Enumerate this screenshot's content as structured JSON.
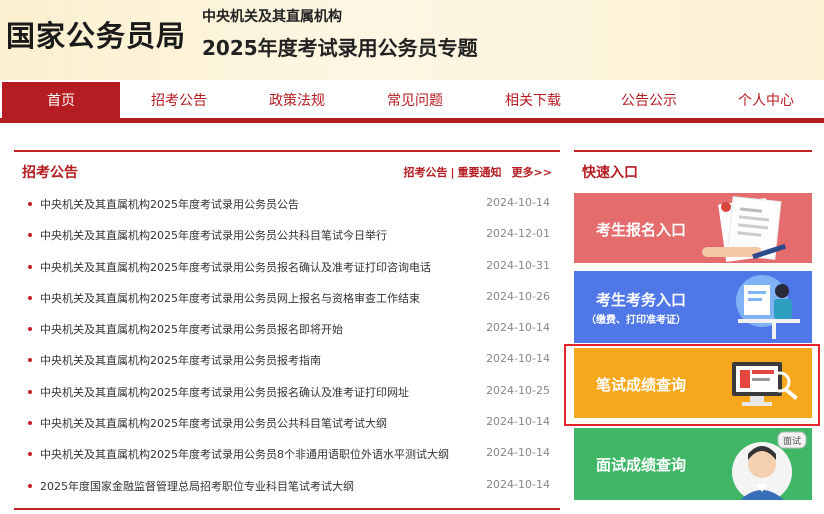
{
  "header": {
    "logo": "国家公务员局",
    "sub1": "中央机关及其直属机构",
    "sub2": "2025年度考试录用公务员专题"
  },
  "nav": {
    "items": [
      "首页",
      "招考公告",
      "政策法规",
      "常见问题",
      "相关下载",
      "公告公示",
      "个人中心"
    ],
    "active_index": 0
  },
  "left_panel": {
    "title": "招考公告",
    "link1": "招考公告",
    "separator": "|",
    "link2": "重要通知",
    "more": "更多>>",
    "news": [
      {
        "title": "中央机关及其直属机构2025年度考试录用公务员公告",
        "date": "2024-10-14"
      },
      {
        "title": "中央机关及其直属机构2025年度考试录用公务员公共科目笔试今日举行",
        "date": "2024-12-01"
      },
      {
        "title": "中央机关及其直属机构2025年度考试录用公务员报名确认及准考证打印咨询电话",
        "date": "2024-10-31"
      },
      {
        "title": "中央机关及其直属机构2025年度考试录用公务员网上报名与资格审查工作结束",
        "date": "2024-10-26"
      },
      {
        "title": "中央机关及其直属机构2025年度考试录用公务员报名即将开始",
        "date": "2024-10-14"
      },
      {
        "title": "中央机关及其直属机构2025年度考试录用公务员报考指南",
        "date": "2024-10-14"
      },
      {
        "title": "中央机关及其直属机构2025年度考试录用公务员报名确认及准考证打印网址",
        "date": "2024-10-25"
      },
      {
        "title": "中央机关及其直属机构2025年度考试录用公务员公共科目笔试考试大纲",
        "date": "2024-10-14"
      },
      {
        "title": "中央机关及其直属机构2025年度考试录用公务员8个非通用语职位外语水平测试大纲",
        "date": "2024-10-14"
      },
      {
        "title": "2025年度国家金融监督管理总局招考职位专业科目笔试考试大纲",
        "date": "2024-10-14"
      }
    ]
  },
  "right_panel": {
    "title": "快速入口",
    "entries": [
      {
        "label": "考生报名入口",
        "icon": "form-sign-icon"
      },
      {
        "label": "考生考务入口",
        "sub": "（缴费、打印准考证）",
        "icon": "student-computer-icon"
      },
      {
        "label": "笔试成绩查询",
        "icon": "monitor-magnifier-icon"
      },
      {
        "label": "面试成绩查询",
        "icon": "interview-person-icon",
        "bubble": "面试"
      }
    ]
  },
  "colors": {
    "brand_red": "#b51d22",
    "entry_red": "#e46c6c",
    "entry_blue": "#4f77e8",
    "entry_orange": "#f7a71b",
    "entry_green": "#3fb766"
  }
}
